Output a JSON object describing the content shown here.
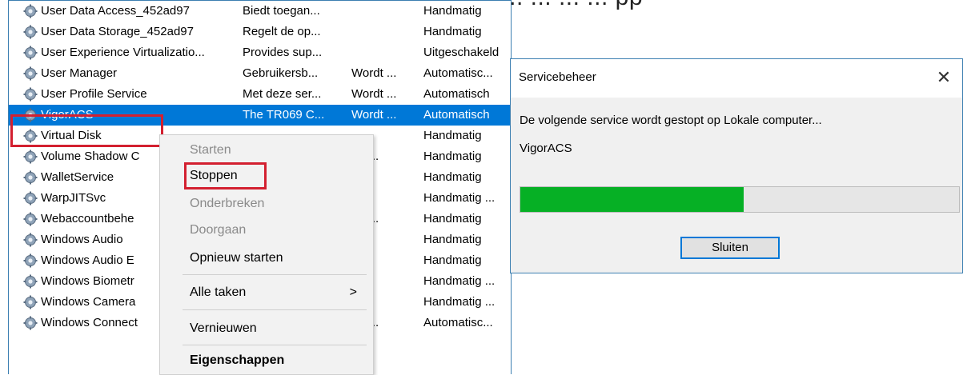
{
  "background_text": "ng ... ... ... ... ... ... ... ... ... ... ... ... ... ... ... ... pp",
  "services": [
    {
      "name": "User Data Access_452ad97",
      "description": "Biedt toegan...",
      "status": "",
      "startup": "Handmatig"
    },
    {
      "name": "User Data Storage_452ad97",
      "description": "Regelt de op...",
      "status": "",
      "startup": "Handmatig"
    },
    {
      "name": "User Experience Virtualizatio...",
      "description": "Provides sup...",
      "status": "",
      "startup": "Uitgeschakeld"
    },
    {
      "name": "User Manager",
      "description": "Gebruikersb...",
      "status": "Wordt ...",
      "startup": "Automatisc..."
    },
    {
      "name": "User Profile Service",
      "description": "Met deze ser...",
      "status": "Wordt ...",
      "startup": "Automatisch"
    },
    {
      "name": "VigorACS",
      "description": "The TR069 C...",
      "status": "Wordt ...",
      "startup": "Automatisch"
    },
    {
      "name": "Virtual Disk",
      "description": "",
      "status": "",
      "startup": "Handmatig"
    },
    {
      "name": "Volume Shadow C",
      "description": "",
      "status": "rdt ...",
      "startup": "Handmatig"
    },
    {
      "name": "WalletService",
      "description": "",
      "status": "",
      "startup": "Handmatig"
    },
    {
      "name": "WarpJITSvc",
      "description": "",
      "status": "",
      "startup": "Handmatig ..."
    },
    {
      "name": "Webaccountbehe",
      "description": "",
      "status": "rdt ...",
      "startup": "Handmatig"
    },
    {
      "name": "Windows Audio",
      "description": "",
      "status": "",
      "startup": "Handmatig"
    },
    {
      "name": "Windows Audio E",
      "description": "",
      "status": "",
      "startup": "Handmatig"
    },
    {
      "name": "Windows Biometr",
      "description": "",
      "status": "",
      "startup": "Handmatig ..."
    },
    {
      "name": "Windows Camera",
      "description": "",
      "status": "",
      "startup": "Handmatig ..."
    },
    {
      "name": "Windows Connect",
      "description": "",
      "status": "rdt ...",
      "startup": "Automatisc..."
    }
  ],
  "context_menu": {
    "start": "Starten",
    "stop": "Stoppen",
    "pause": "Onderbreken",
    "resume": "Doorgaan",
    "restart": "Opnieuw starten",
    "all_tasks": "Alle taken",
    "all_tasks_arrow": ">",
    "refresh": "Vernieuwen",
    "properties": "Eigenschappen"
  },
  "dialog": {
    "title": "Servicebeheer",
    "close": "✕",
    "message": "De volgende service wordt gestopt op Lokale computer...",
    "service_name": "VigorACS",
    "progress_percent": 51,
    "progress_color": "#06b025",
    "button": "Sluiten"
  },
  "colors": {
    "selection": "#0078d7",
    "annotation": "#d32030"
  }
}
